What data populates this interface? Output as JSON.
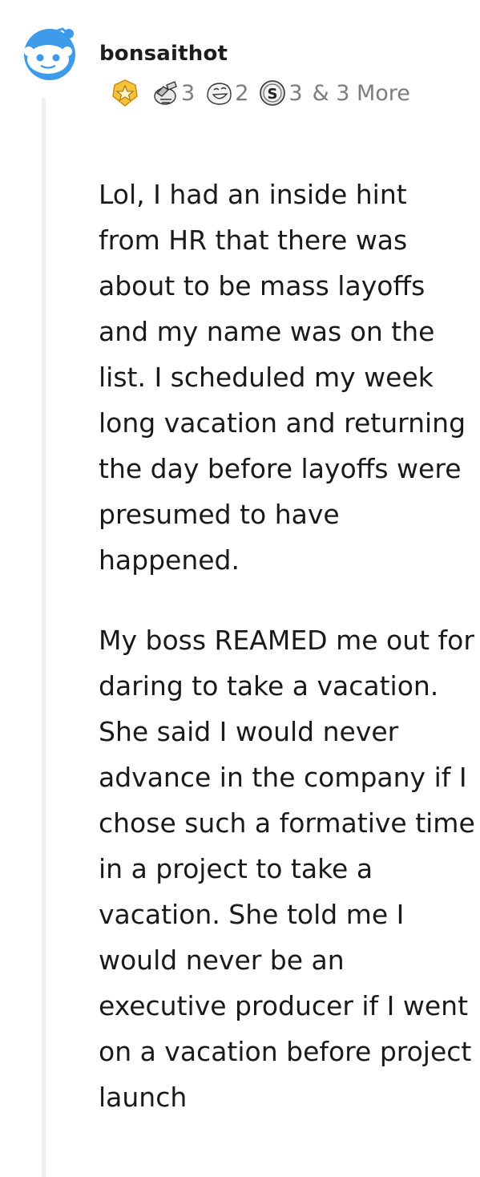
{
  "comment": {
    "username": "bonsaithot",
    "awards": [
      {
        "icon": "gold-badge-icon",
        "count": ""
      },
      {
        "icon": "gavel-hand-icon",
        "count": "3"
      },
      {
        "icon": "laughing-face-icon",
        "count": "2"
      },
      {
        "icon": "silver-coin-icon",
        "count": "3"
      }
    ],
    "awards_more": "& 3 More",
    "paragraphs": [
      "Lol, I had an inside hint from HR that there was about to be mass layoffs and my name was on the list. I scheduled my week long vacation and returning the day before layoffs were presumed to have happened.",
      "My boss REAMED me out for daring to take a vacation. She said I would never advance in the company if I chose such a formative time in a project to take a vacation. She told me I would never be an executive producer if I went on a vacation before project launch"
    ]
  },
  "colors": {
    "avatar_blue": "#3d9be9",
    "award_gold": "#f5c33b",
    "thread_line": "#edeff1",
    "meta_text": "#7c7c7c"
  }
}
